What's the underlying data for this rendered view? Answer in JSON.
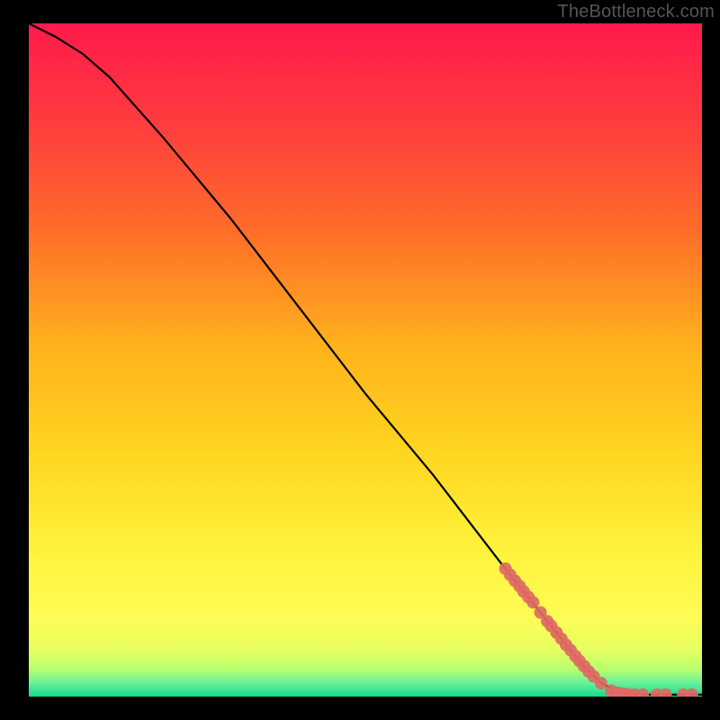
{
  "watermark": "TheBottleneck.com",
  "chart_data": {
    "type": "line",
    "title": "",
    "xlabel": "",
    "ylabel": "",
    "xlim": [
      0,
      100
    ],
    "ylim": [
      0,
      100
    ],
    "curve": [
      {
        "x": 0,
        "y": 100
      },
      {
        "x": 4,
        "y": 98
      },
      {
        "x": 8,
        "y": 95.5
      },
      {
        "x": 12,
        "y": 92
      },
      {
        "x": 20,
        "y": 83
      },
      {
        "x": 30,
        "y": 71
      },
      {
        "x": 40,
        "y": 58
      },
      {
        "x": 50,
        "y": 45
      },
      {
        "x": 60,
        "y": 33
      },
      {
        "x": 70,
        "y": 20
      },
      {
        "x": 78,
        "y": 10
      },
      {
        "x": 82,
        "y": 5
      },
      {
        "x": 85,
        "y": 2
      },
      {
        "x": 88,
        "y": 0.5
      },
      {
        "x": 92,
        "y": 0.3
      },
      {
        "x": 96,
        "y": 0.3
      },
      {
        "x": 100,
        "y": 0.3
      }
    ],
    "highlight_points": [
      {
        "x": 70.8,
        "y": 19.0
      },
      {
        "x": 71.5,
        "y": 18.1
      },
      {
        "x": 72.2,
        "y": 17.2
      },
      {
        "x": 72.9,
        "y": 16.4
      },
      {
        "x": 73.5,
        "y": 15.6
      },
      {
        "x": 74.2,
        "y": 14.8
      },
      {
        "x": 74.9,
        "y": 14.0
      },
      {
        "x": 76.0,
        "y": 12.5
      },
      {
        "x": 77.0,
        "y": 11.2
      },
      {
        "x": 77.6,
        "y": 10.5
      },
      {
        "x": 78.4,
        "y": 9.5
      },
      {
        "x": 79.1,
        "y": 8.6
      },
      {
        "x": 79.8,
        "y": 7.7
      },
      {
        "x": 80.5,
        "y": 6.9
      },
      {
        "x": 81.2,
        "y": 6.0
      },
      {
        "x": 81.8,
        "y": 5.3
      },
      {
        "x": 82.5,
        "y": 4.5
      },
      {
        "x": 83.2,
        "y": 3.7
      },
      {
        "x": 83.9,
        "y": 3.0
      },
      {
        "x": 85.0,
        "y": 2.0
      },
      {
        "x": 86.5,
        "y": 0.9
      },
      {
        "x": 87.2,
        "y": 0.6
      },
      {
        "x": 87.8,
        "y": 0.5
      },
      {
        "x": 88.5,
        "y": 0.4
      },
      {
        "x": 89.2,
        "y": 0.3
      },
      {
        "x": 90.0,
        "y": 0.3
      },
      {
        "x": 91.2,
        "y": 0.3
      },
      {
        "x": 93.3,
        "y": 0.3
      },
      {
        "x": 94.6,
        "y": 0.3
      },
      {
        "x": 97.2,
        "y": 0.3
      },
      {
        "x": 98.5,
        "y": 0.3
      }
    ],
    "gradient_bands": [
      {
        "y0": 100,
        "y1": 70,
        "from": "#ff1a4b",
        "to": "#ff6a2a"
      },
      {
        "y0": 70,
        "y1": 40,
        "from": "#ff6a2a",
        "to": "#ffd21f"
      },
      {
        "y0": 40,
        "y1": 12,
        "from": "#ffd21f",
        "to": "#fff94a"
      },
      {
        "y0": 12,
        "y1": 4,
        "from": "#fff94a",
        "to": "#d8ff5a"
      },
      {
        "y0": 4,
        "y1": 0,
        "from": "#8dff7a",
        "to": "#18e08a"
      }
    ]
  }
}
